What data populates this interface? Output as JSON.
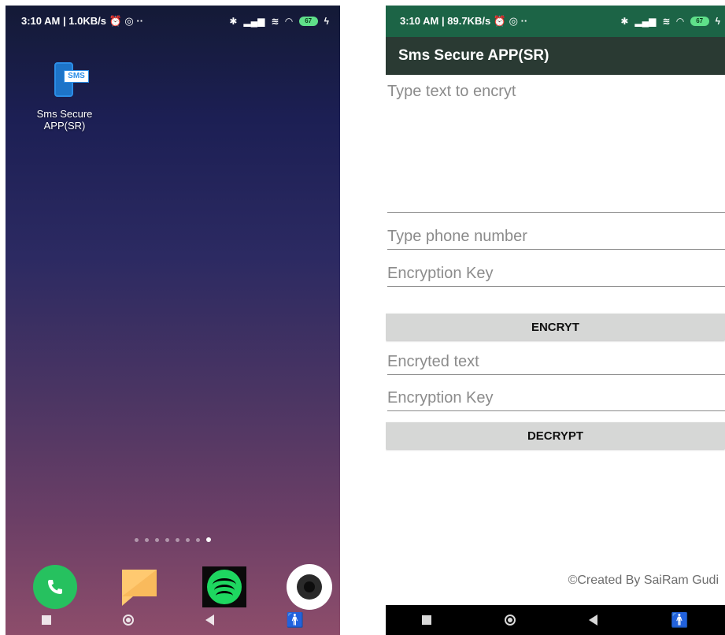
{
  "home_screen": {
    "status_bar": {
      "time": "3:10 AM",
      "net_speed": "1.0KB/s",
      "extra": "··",
      "battery": "67"
    },
    "app_icon": {
      "badge_text": "SMS",
      "label": "Sms Secure APP(SR)"
    },
    "page_dots_count": 8,
    "active_page": 8,
    "dock": [
      "phone-icon",
      "messages-icon",
      "spotify-icon",
      "camera-icon"
    ]
  },
  "app_screen": {
    "status_bar": {
      "time": "3:10 AM",
      "net_speed": "89.7KB/s",
      "extra": "··",
      "battery": "67"
    },
    "title": "Sms Secure APP(SR)",
    "message_input": {
      "placeholder": "Type text to encryt"
    },
    "phone_input": {
      "placeholder": "Type phone  number"
    },
    "encryption_key_input": {
      "placeholder": "Encryption Key"
    },
    "encrypt_button": "ENCRYT",
    "encrypted_text_input": {
      "placeholder": "Encryted text"
    },
    "decryption_key_input": {
      "placeholder": "Encryption Key"
    },
    "decrypt_button": "DECRYPT",
    "credit": "©Created By SaiRam Gudi"
  },
  "colors": {
    "status_bar_app": "#1c6446",
    "app_bar": "#2a3a33",
    "button_bg": "#d6d7d6",
    "dock_phone": "#26c15f",
    "spotify_green": "#1ed760"
  }
}
